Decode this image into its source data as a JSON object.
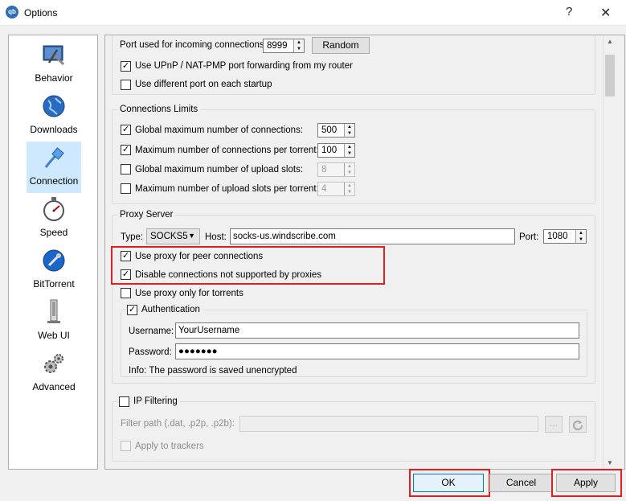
{
  "window": {
    "title": "Options",
    "help_glyph": "?",
    "close_glyph": "✕",
    "app_icon_text": "qb"
  },
  "sidebar": {
    "items": [
      {
        "label": "Behavior",
        "icon": "behavior-icon"
      },
      {
        "label": "Downloads",
        "icon": "downloads-globe-icon"
      },
      {
        "label": "Connection",
        "icon": "connection-icon",
        "active": true
      },
      {
        "label": "Speed",
        "icon": "speed-stopwatch-icon"
      },
      {
        "label": "BitTorrent",
        "icon": "bittorrent-icon"
      },
      {
        "label": "Web UI",
        "icon": "web-ui-icon"
      },
      {
        "label": "Advanced",
        "icon": "advanced-gears-icon"
      }
    ]
  },
  "listening": {
    "port_label": "Port used for incoming connections:",
    "port_value": "8999",
    "random_button": "Random",
    "upnp_label": "Use UPnP / NAT-PMP port forwarding from my router",
    "upnp_checked": true,
    "diff_port_label": "Use different port on each startup",
    "diff_port_checked": false
  },
  "limits": {
    "title": "Connections Limits",
    "global_max_label": "Global maximum number of connections:",
    "global_max_value": "500",
    "per_torrent_label": "Maximum number of connections per torrent:",
    "per_torrent_value": "100",
    "upload_slots_label": "Global maximum number of upload slots:",
    "upload_slots_value": "8",
    "upload_per_torrent_label": "Maximum number of upload slots per torrent:",
    "upload_per_torrent_value": "4"
  },
  "proxy": {
    "title": "Proxy Server",
    "type_label": "Type:",
    "type_value": "SOCKS5",
    "host_label": "Host:",
    "host_value": "socks-us.windscribe.com",
    "port_label": "Port:",
    "port_value": "1080",
    "peer_label": "Use proxy for peer connections",
    "peer_checked": true,
    "disable_label": "Disable connections not supported by proxies",
    "disable_checked": true,
    "only_torrents_label": "Use proxy only for torrents",
    "only_torrents_checked": false,
    "auth": {
      "title": "Authentication",
      "checked": true,
      "username_label": "Username:",
      "username_value": "YourUsername",
      "password_label": "Password:",
      "password_value": "●●●●●●●",
      "info": "Info: The password is saved unencrypted"
    }
  },
  "ipfilter": {
    "title": "IP Filtering",
    "checked": false,
    "path_label": "Filter path (.dat, .p2p, .p2b):",
    "path_value": "",
    "browse_label": "...",
    "apply_trackers_label": "Apply to trackers"
  },
  "footer": {
    "ok": "OK",
    "cancel": "Cancel",
    "apply": "Apply"
  },
  "colors": {
    "highlight_box": "#e02020",
    "active_sidebar": "#cde8ff",
    "focus_border": "#0078d7"
  }
}
